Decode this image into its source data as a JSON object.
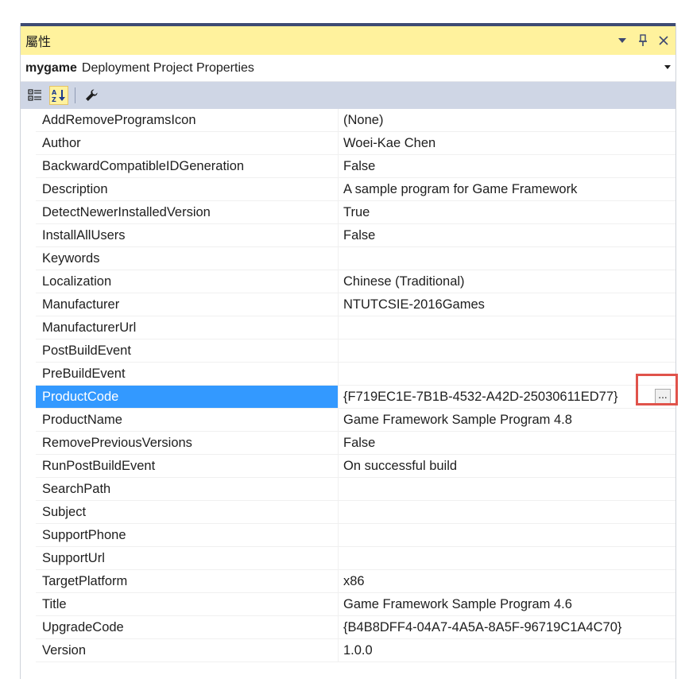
{
  "panel": {
    "title": "屬性",
    "object_name": "mygame",
    "object_type": "Deployment Project Properties"
  },
  "icons": {
    "dropdown": "chevron-down-icon",
    "pin": "pin-icon",
    "close": "close-icon",
    "categorized": "categorized-icon",
    "alphabetical": "alphabetical-icon",
    "property_pages": "wrench-icon"
  },
  "colors": {
    "title_bg": "#fff29d",
    "title_border": "#3e4b73",
    "toolbar_bg": "#cfd6e5",
    "selection": "#3399ff",
    "highlight": "#e0534b"
  },
  "properties": [
    {
      "name": "AddRemoveProgramsIcon",
      "value": "(None)"
    },
    {
      "name": "Author",
      "value": "Woei-Kae Chen"
    },
    {
      "name": "BackwardCompatibleIDGeneration",
      "value": "False"
    },
    {
      "name": "Description",
      "value": "A sample program for Game Framework"
    },
    {
      "name": "DetectNewerInstalledVersion",
      "value": "True"
    },
    {
      "name": "InstallAllUsers",
      "value": "False"
    },
    {
      "name": "Keywords",
      "value": ""
    },
    {
      "name": "Localization",
      "value": "Chinese (Traditional)"
    },
    {
      "name": "Manufacturer",
      "value": "NTUTCSIE-2016Games"
    },
    {
      "name": "ManufacturerUrl",
      "value": ""
    },
    {
      "name": "PostBuildEvent",
      "value": ""
    },
    {
      "name": "PreBuildEvent",
      "value": ""
    },
    {
      "name": "ProductCode",
      "value": "{F719EC1E-7B1B-4532-A42D-25030611ED77}",
      "selected": true,
      "button_label": "..."
    },
    {
      "name": "ProductName",
      "value": "Game Framework Sample Program 4.8"
    },
    {
      "name": "RemovePreviousVersions",
      "value": "False"
    },
    {
      "name": "RunPostBuildEvent",
      "value": "On successful build"
    },
    {
      "name": "SearchPath",
      "value": ""
    },
    {
      "name": "Subject",
      "value": ""
    },
    {
      "name": "SupportPhone",
      "value": ""
    },
    {
      "name": "SupportUrl",
      "value": ""
    },
    {
      "name": "TargetPlatform",
      "value": "x86"
    },
    {
      "name": "Title",
      "value": "Game Framework Sample Program 4.6"
    },
    {
      "name": "UpgradeCode",
      "value": "{B4B8DFF4-04A7-4A5A-8A5F-96719C1A4C70}"
    },
    {
      "name": "Version",
      "value": "1.0.0"
    }
  ]
}
